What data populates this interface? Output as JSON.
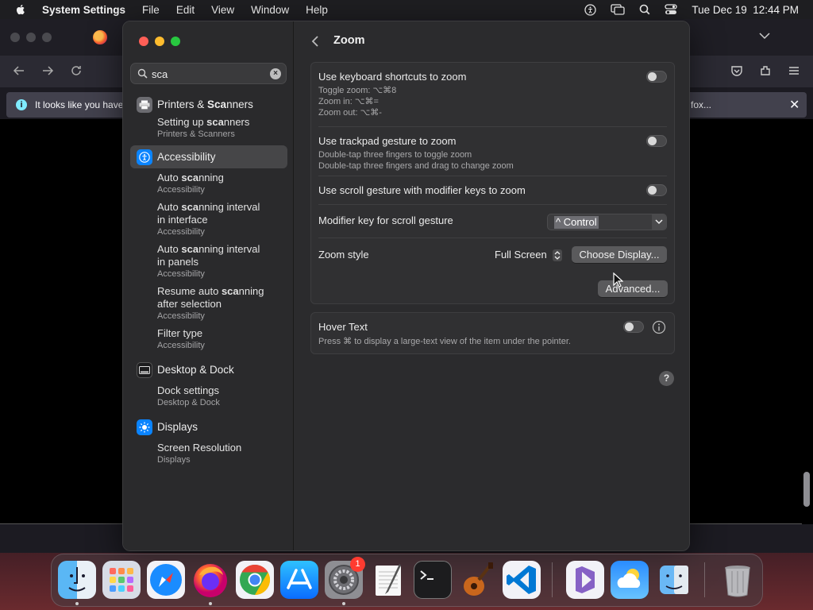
{
  "menubar": {
    "app_name": "System Settings",
    "menus": [
      "File",
      "Edit",
      "View",
      "Window",
      "Help"
    ],
    "datetime": "Tue Dec 19  12:44 PM"
  },
  "browser": {
    "info_text": "It looks like you have",
    "info_text_right": "fox..."
  },
  "search": {
    "value": "sca"
  },
  "sidebar": {
    "groups": [
      {
        "category": "Printers & Scanners",
        "icon": "printer-icon",
        "selected": false,
        "results": [
          {
            "title": "Setting up scanners",
            "subtitle": "Printers & Scanners"
          }
        ]
      },
      {
        "category": "Accessibility",
        "icon": "accessibility-icon",
        "selected": true,
        "results": [
          {
            "title": "Auto scanning",
            "subtitle": "Accessibility"
          },
          {
            "title": "Auto scanning interval in interface",
            "subtitle": "Accessibility"
          },
          {
            "title": "Auto scanning interval in panels",
            "subtitle": "Accessibility"
          },
          {
            "title": "Resume auto scanning after selection",
            "subtitle": "Accessibility"
          },
          {
            "title": "Filter type",
            "subtitle": "Accessibility"
          }
        ]
      },
      {
        "category": "Desktop & Dock",
        "icon": "desktop-dock-icon",
        "selected": false,
        "results": [
          {
            "title": "Dock settings",
            "subtitle": "Desktop & Dock"
          }
        ]
      },
      {
        "category": "Displays",
        "icon": "displays-icon",
        "selected": false,
        "results": [
          {
            "title": "Screen Resolution",
            "subtitle": "Displays"
          }
        ]
      }
    ]
  },
  "main": {
    "title": "Zoom",
    "keyboard_shortcuts": {
      "label": "Use keyboard shortcuts to zoom",
      "desc": [
        "Toggle zoom: ⌥⌘8",
        "Zoom in: ⌥⌘=",
        "Zoom out: ⌥⌘-"
      ],
      "enabled": false
    },
    "trackpad": {
      "label": "Use trackpad gesture to zoom",
      "desc": [
        "Double-tap three fingers to toggle zoom",
        "Double-tap three fingers and drag to change zoom"
      ],
      "enabled": false
    },
    "scroll_gesture": {
      "label": "Use scroll gesture with modifier keys to zoom",
      "enabled": false
    },
    "modifier_key": {
      "label": "Modifier key for scroll gesture",
      "value": "^ Control"
    },
    "zoom_style": {
      "label": "Zoom style",
      "value": "Full Screen",
      "choose_display": "Choose Display..."
    },
    "advanced_button": "Advanced...",
    "hover_text": {
      "label": "Hover Text",
      "desc": "Press ⌘ to display a large-text view of the item under the pointer.",
      "enabled": false
    },
    "help": "?"
  },
  "dock": {
    "apps": [
      {
        "name": "Finder",
        "running": true
      },
      {
        "name": "Launchpad",
        "running": false
      },
      {
        "name": "Safari",
        "running": false
      },
      {
        "name": "Firefox",
        "running": true
      },
      {
        "name": "Chrome",
        "running": false
      },
      {
        "name": "App Store",
        "running": false
      },
      {
        "name": "System Settings",
        "running": true,
        "badge": "1"
      },
      {
        "name": "TextEdit",
        "running": false
      },
      {
        "name": "Terminal",
        "running": false
      },
      {
        "name": "GarageBand",
        "running": false
      },
      {
        "name": "Visual Studio Code",
        "running": false
      },
      {
        "name": "Visual Studio",
        "running": false
      },
      {
        "name": "Weather",
        "running": false
      },
      {
        "name": "Finder Files",
        "running": false
      },
      {
        "name": "Trash",
        "running": false
      }
    ]
  },
  "colors": {
    "accent": "#0a84ff",
    "selection": "#464648",
    "red": "#ff5f57",
    "yellow": "#febc2e",
    "green": "#28c840"
  }
}
